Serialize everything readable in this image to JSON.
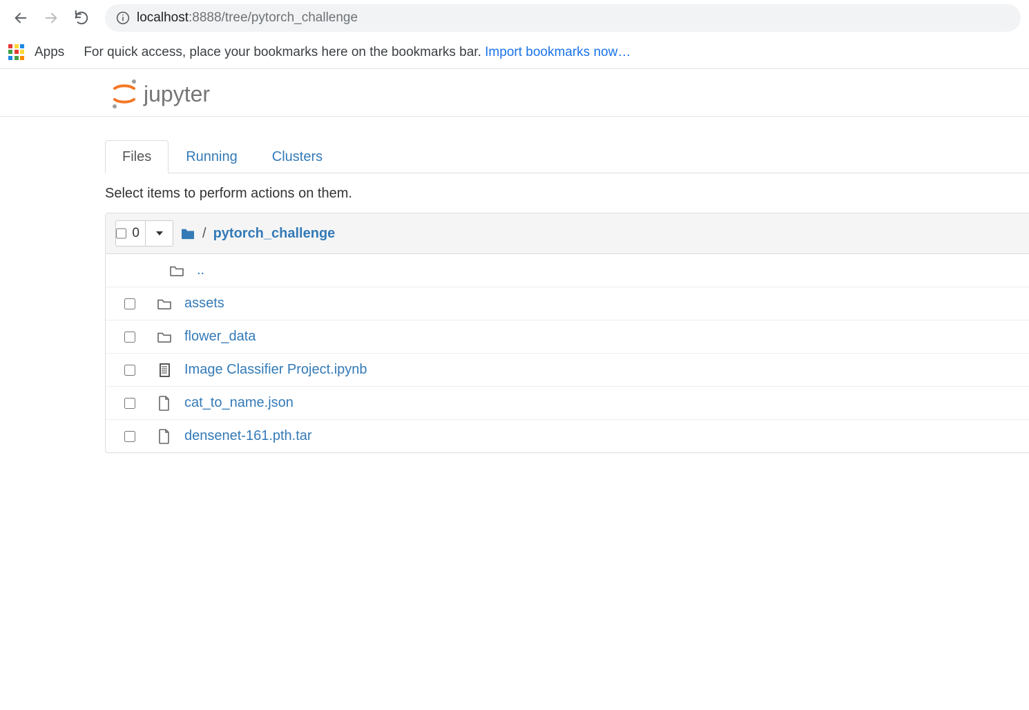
{
  "browser": {
    "url_host": "localhost",
    "url_rest": ":8888/tree/pytorch_challenge"
  },
  "bookmarks": {
    "apps_label": "Apps",
    "hint_text": "For quick access, place your bookmarks here on the bookmarks bar. ",
    "import_link": "Import bookmarks now…"
  },
  "header": {
    "logo_text": "jupyter"
  },
  "tabs": [
    {
      "label": "Files",
      "active": true
    },
    {
      "label": "Running",
      "active": false
    },
    {
      "label": "Clusters",
      "active": false
    }
  ],
  "action_hint": "Select items to perform actions on them.",
  "breadcrumb": {
    "selected_count": "0",
    "separator": "/",
    "current_folder": "pytorch_challenge"
  },
  "files": [
    {
      "type": "parent",
      "name": ".."
    },
    {
      "type": "folder",
      "name": "assets"
    },
    {
      "type": "folder",
      "name": "flower_data"
    },
    {
      "type": "notebook",
      "name": "Image Classifier Project.ipynb"
    },
    {
      "type": "file",
      "name": "cat_to_name.json"
    },
    {
      "type": "file",
      "name": "densenet-161.pth.tar"
    }
  ]
}
